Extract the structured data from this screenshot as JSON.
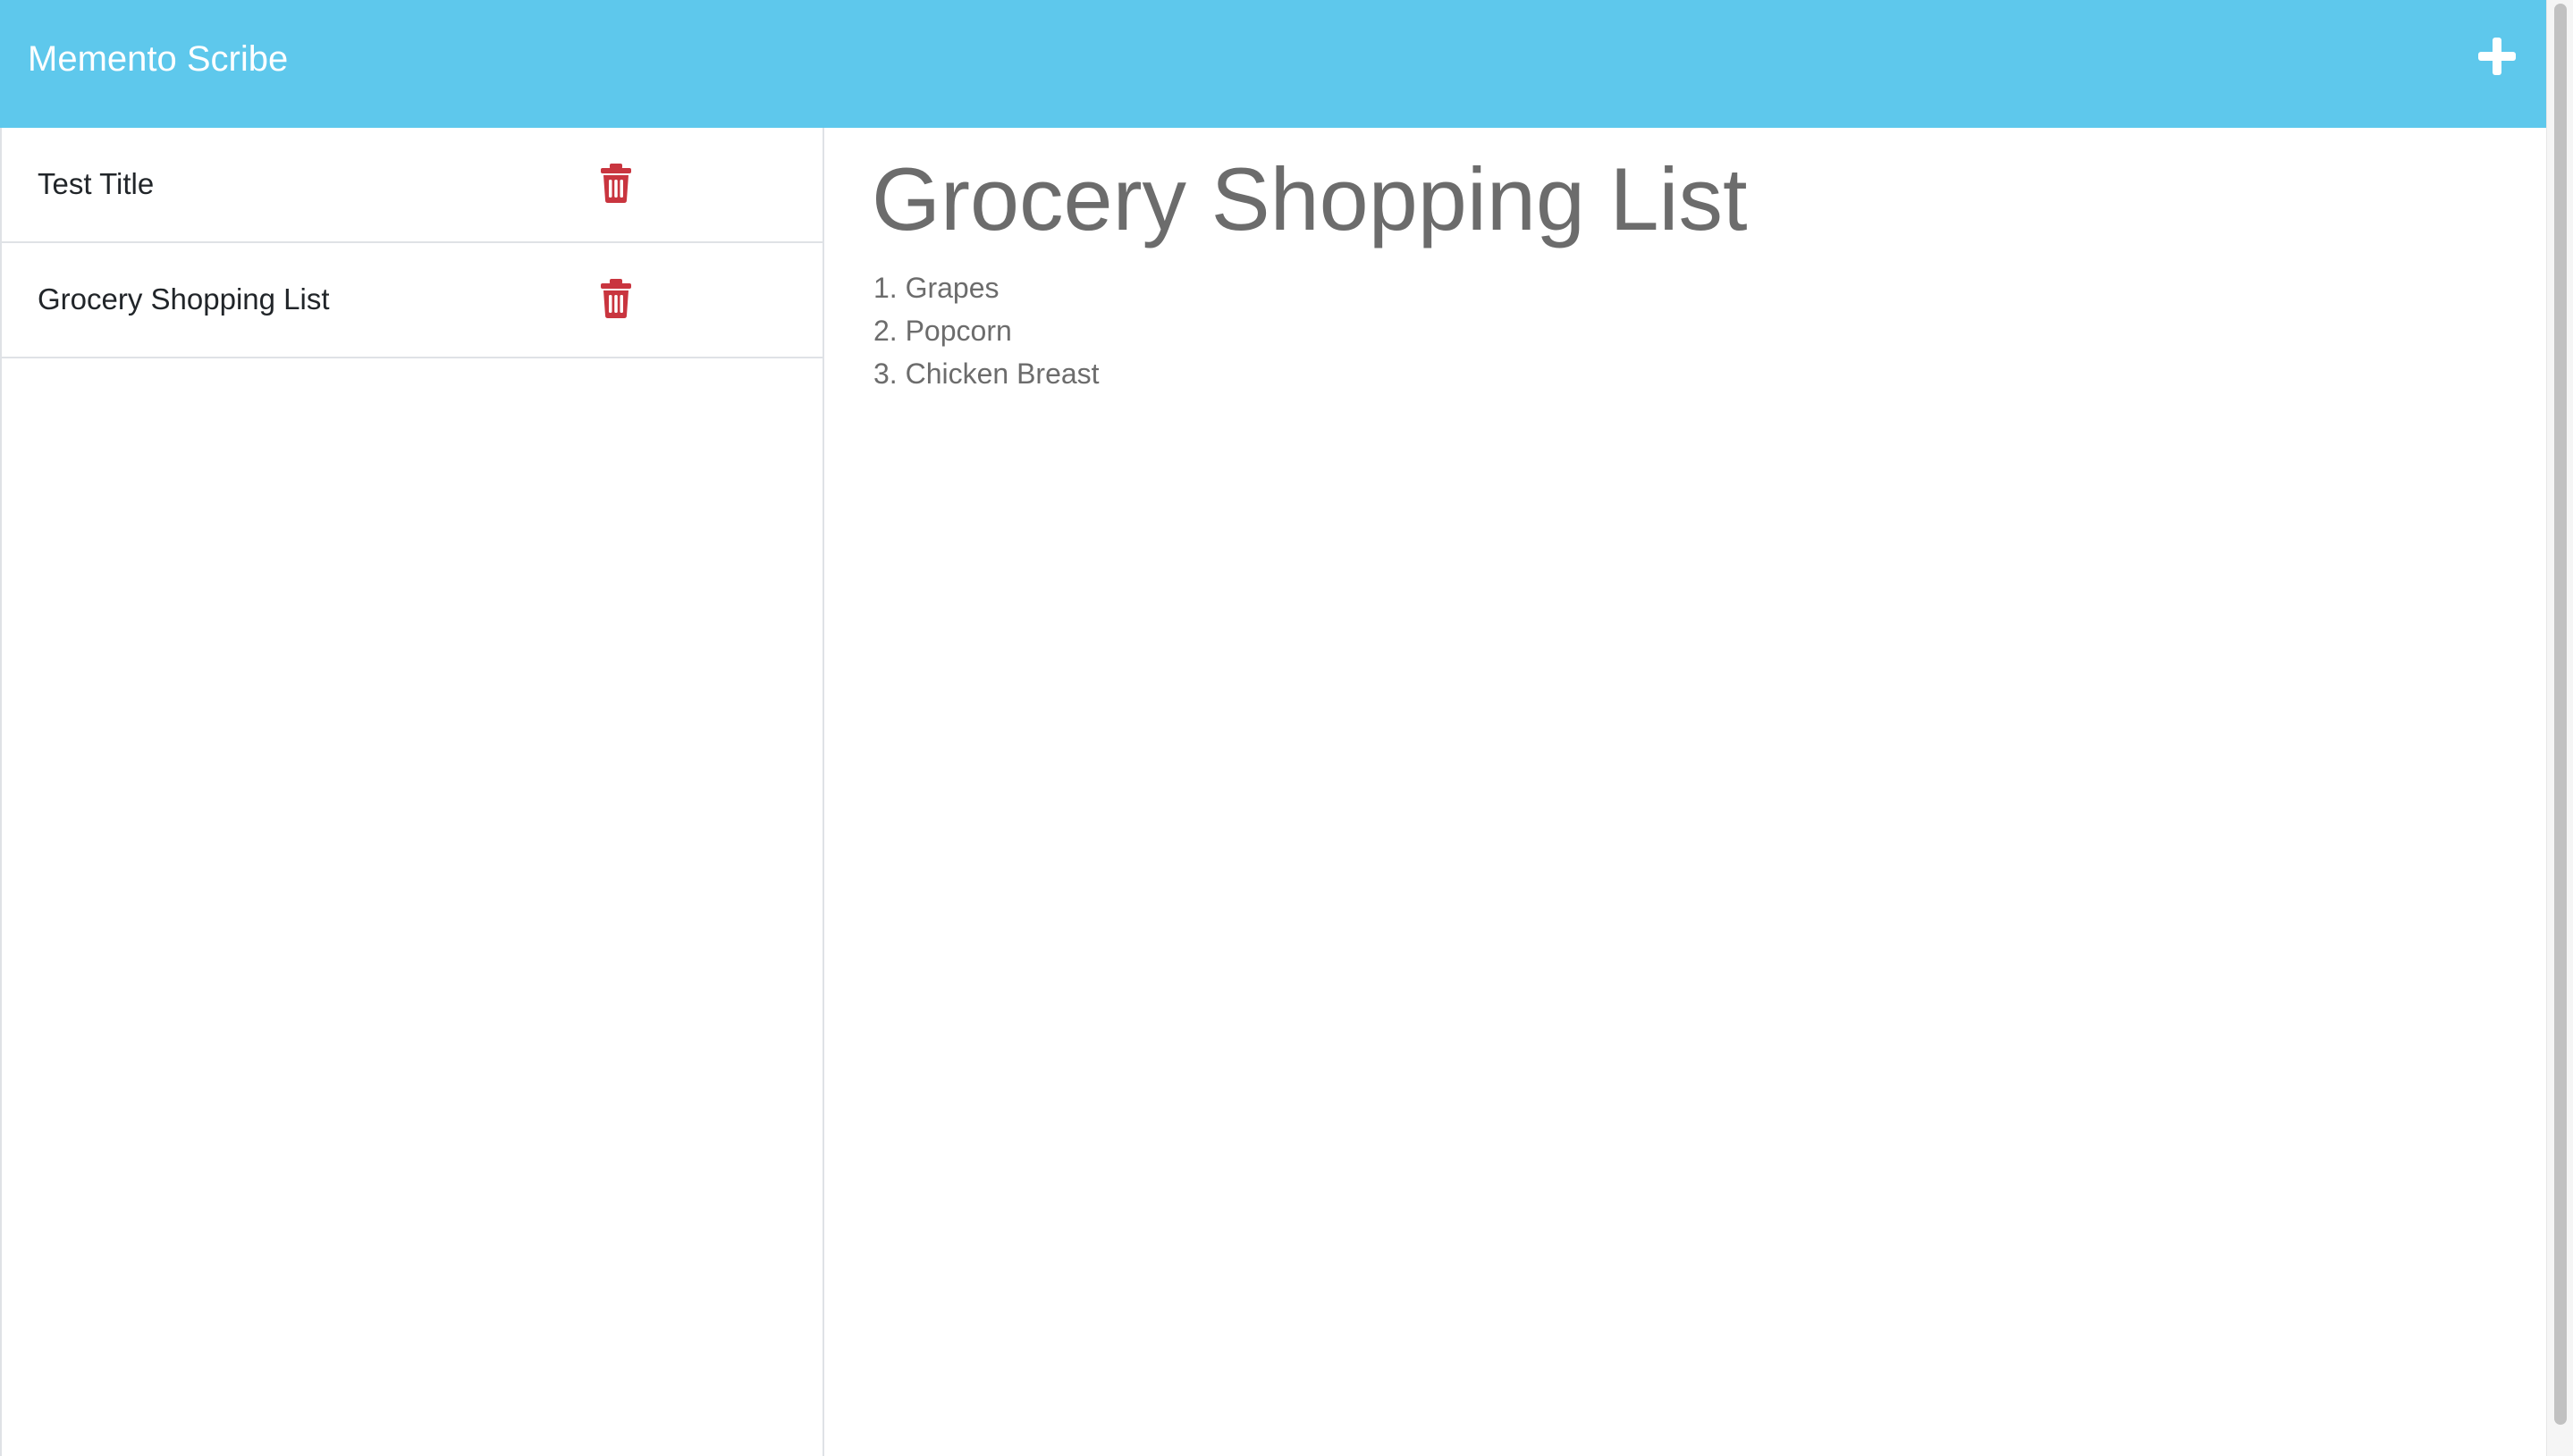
{
  "app": {
    "title": "Memento Scribe",
    "accent_color": "#5ec8ec",
    "add_icon": "plus-icon"
  },
  "sidebar": {
    "items": [
      {
        "title": "Test Title",
        "delete_icon": "trash-icon"
      },
      {
        "title": "Grocery Shopping List",
        "delete_icon": "trash-icon"
      }
    ],
    "delete_color": "#c9353f"
  },
  "note": {
    "title": "Grocery Shopping List",
    "body": "1. Grapes\n2. Popcorn\n3. Chicken Breast"
  }
}
